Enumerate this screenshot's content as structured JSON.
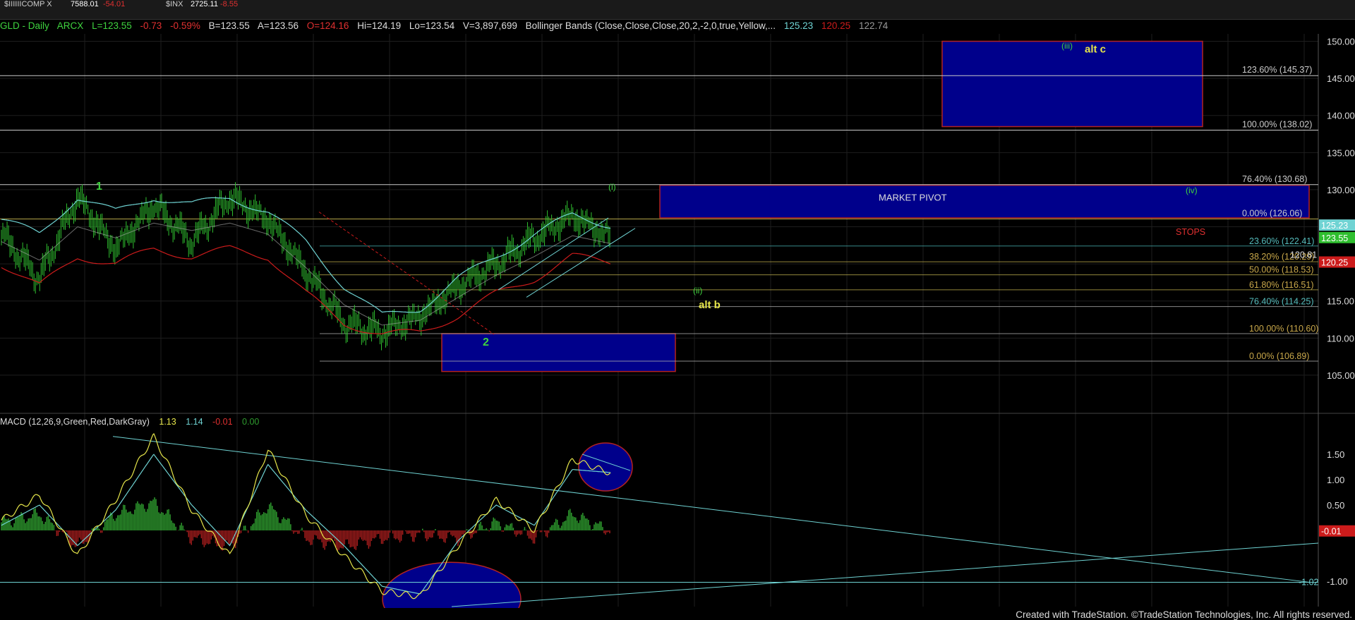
{
  "top_strip": {
    "items": [
      {
        "label": "$IIIIIICOMP X",
        "value": "7588.01",
        "change": "-54.01"
      },
      {
        "label": "$INX",
        "value": "2725.11",
        "change": "-8.55"
      }
    ]
  },
  "header": {
    "symbol": "GLD - Daily",
    "exchange": "ARCX",
    "last": "L=123.55",
    "change": "-0.73",
    "pct": "-0.59%",
    "bid": "B=123.55",
    "ask": "A=123.56",
    "open": "O=124.16",
    "high": "Hi=124.19",
    "low": "Lo=123.54",
    "volume": "V=3,897,699",
    "study": "Bollinger Bands (Close,Close,Close,20,2,-2,0,true,Yellow,...",
    "bb_upper": "125.23",
    "bb_lower": "120.25",
    "bb_mid": "122.74"
  },
  "macd_header": {
    "study": "MACD (12,26,9,Green,Red,DarkGray)",
    "macd": "1.13",
    "signal": "1.14",
    "diff": "-0.01",
    "zero": "0.00"
  },
  "footer": "Created with TradeStation. ©TradeStation Technologies, Inc. All rights reserved.",
  "colors": {
    "candle": "#2fbf2f",
    "bb_upper": "#6fd3d3",
    "bb_lower": "#cc1b1b",
    "bb_mid": "#b0b0b0",
    "box": "#00008b",
    "box_border": "#b22222",
    "macd_line": "#e6e64a",
    "signal_line": "#6fd3d3",
    "hist_pos": "#2e9b2e",
    "hist_neg": "#a11c1c",
    "label_green": "#3fd33f",
    "label_yellow": "#e6e64a"
  },
  "chart_data": [
    {
      "type": "line",
      "title": "GLD - Daily",
      "ylim": [
        101,
        151
      ],
      "y_ticks": [
        "105.00",
        "110.00",
        "115.00",
        "120.00",
        "125.00",
        "130.00",
        "135.00",
        "140.00",
        "145.00",
        "150.00"
      ],
      "last_price_tags": [
        {
          "text": "125.23",
          "value": 125.23,
          "color": "#6fd3d3"
        },
        {
          "text": "123.55",
          "value": 123.55,
          "color": "#2fbf2f"
        },
        {
          "text": "120.25",
          "value": 120.25,
          "color": "#cc1b1b"
        }
      ],
      "price_approx": [
        124,
        118,
        129,
        122,
        128,
        123,
        129,
        126,
        119,
        112,
        110.8,
        113,
        117,
        120,
        123.5,
        126.5,
        123.55
      ],
      "series": [
        {
          "values": [
            124,
            118,
            129,
            122,
            128,
            123,
            129,
            126,
            119,
            112,
            110.8,
            113,
            117,
            120,
            123.5,
            126.5,
            123.55
          ]
        },
        {
          "values": [
            126,
            124,
            129,
            127,
            129,
            128,
            129,
            127,
            123,
            117,
            113,
            114,
            118,
            121,
            124,
            126.6,
            125.23
          ]
        },
        {
          "values": [
            120,
            117,
            121,
            120,
            122,
            121,
            122,
            121,
            116,
            112,
            110.5,
            110.8,
            113,
            116,
            118,
            121,
            120.25
          ]
        }
      ],
      "fib_levels_upper": [
        {
          "text": "123.60% (145.37)",
          "value": 145.37
        },
        {
          "text": "100.00% (138.02)",
          "value": 138.02
        },
        {
          "text": "76.40% (130.68)",
          "value": 130.68
        },
        {
          "text": "0.00% (126.06)",
          "value": 126.06
        }
      ],
      "fib_levels_lower": [
        {
          "text": "23.60% (122.41)",
          "value": 122.41
        },
        {
          "text": "38.20% (120.29)",
          "value": 120.29
        },
        {
          "text": "50.00% (118.53)",
          "value": 118.53
        },
        {
          "text": "61.80% (116.51)",
          "value": 116.51
        },
        {
          "text": "76.40% (114.25)",
          "value": 114.25
        },
        {
          "text": "100.00% (110.60)",
          "value": 110.6
        },
        {
          "text": "0.00% (106.89)",
          "value": 106.89
        }
      ],
      "annotations": [
        {
          "text": "1",
          "value": 130
        },
        {
          "text": "2",
          "value": 109
        },
        {
          "text": "(i)",
          "value": 130
        },
        {
          "text": "(ii)",
          "value": 116
        },
        {
          "text": "alt b",
          "value": 114
        },
        {
          "text": "(iii)",
          "value": 149
        },
        {
          "text": "alt c",
          "value": 148.5
        },
        {
          "text": "(iv)",
          "value": 129.5
        },
        {
          "text": "MARKET PIVOT",
          "value": 128.5
        },
        {
          "text": "STOPS",
          "value": 123.9
        },
        {
          "text": "120.81",
          "value": 120.81
        }
      ],
      "boxes": [
        {
          "name": "alt-c-target-box",
          "y_top": 150,
          "y_bottom": 138.5
        },
        {
          "name": "market-pivot-box",
          "y_top": 130.6,
          "y_bottom": 126.2
        },
        {
          "name": "wave-2-support-box",
          "y_top": 110.6,
          "y_bottom": 105.5
        }
      ]
    },
    {
      "type": "line",
      "title": "MACD (12,26,9,Green,Red,DarkGray)",
      "ylim": [
        -1.5,
        2.0
      ],
      "y_ticks": [
        "1.50",
        "1.00",
        "0.50",
        "-1.00"
      ],
      "value_tags": [
        {
          "text": "-0.01",
          "value": -0.01,
          "color": "#cc1b1b"
        },
        {
          "text": "-1.02",
          "value": -1.02,
          "color": "#6fd3d3"
        }
      ],
      "series": [
        {
          "values": [
            0.2,
            0.7,
            -0.5,
            0.6,
            1.85,
            0.4,
            -0.5,
            1.6,
            0.3,
            -0.5,
            -1.2,
            -1.3,
            -0.3,
            0.6,
            0.0,
            1.4,
            1.13
          ]
        },
        {
          "values": [
            0.1,
            0.5,
            -0.3,
            0.4,
            1.5,
            0.5,
            -0.3,
            1.3,
            0.4,
            -0.3,
            -1.1,
            -1.25,
            -0.2,
            0.5,
            0.1,
            1.2,
            1.14
          ]
        }
      ]
    }
  ]
}
